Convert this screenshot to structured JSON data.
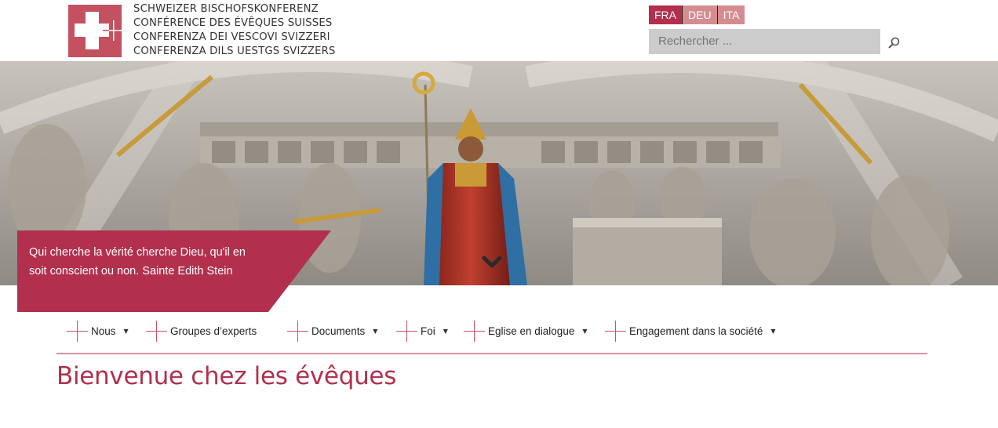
{
  "header": {
    "logo_lines": [
      "SCHWEIZER BISCHOFSKONFERENZ",
      "CONFÉRENCE DES ÉVÊQUES SUISSES",
      "CONFERENZA DEI VESCOVI SVIZZERI",
      "CONFERENZA DILS UESTGS SVIZZERS"
    ],
    "languages": [
      {
        "label": "FRA",
        "active": true
      },
      {
        "label": "DEU",
        "active": false
      },
      {
        "label": "ITA",
        "active": false
      }
    ],
    "search": {
      "placeholder": "Rechercher ...",
      "value": "",
      "icon": "search-icon"
    }
  },
  "hero": {
    "quote": "Qui cherche la vérité cherche Dieu, qu'il en soit conscient ou non. Sainte Edith Stein",
    "scroll_icon": "chevron-down-icon"
  },
  "nav": {
    "items": [
      {
        "label": "Nous",
        "dropdown": true
      },
      {
        "label": "Groupes d’experts",
        "dropdown": false
      },
      {
        "label": "Documents",
        "dropdown": true
      },
      {
        "label": "Foi",
        "dropdown": true
      },
      {
        "label": "Eglise en dialogue",
        "dropdown": true
      },
      {
        "label": "Engagement dans la société",
        "dropdown": true
      }
    ],
    "caret": "▼"
  },
  "main": {
    "title": "Bienvenue chez les évêques"
  },
  "colors": {
    "brand": "#b2304d",
    "lang_inactive": "#d58c90",
    "search_bg": "#cccccc",
    "cross": "#c85366"
  }
}
